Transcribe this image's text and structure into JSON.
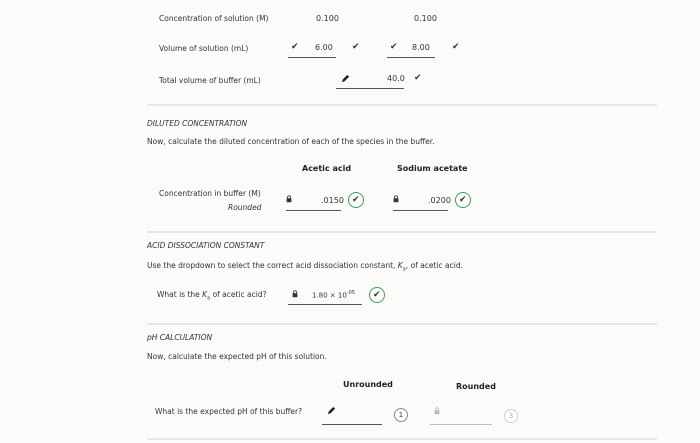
{
  "top": {
    "conc_label": "Concentration of solution (M)",
    "conc_val_1": "0.100",
    "conc_val_2": "0.100",
    "vol_label": "Volume of solution (mL)",
    "vol_val_1": "6.00",
    "vol_val_2": "8.00",
    "total_label": "Total volume of buffer (mL)",
    "total_val": "40.0"
  },
  "diluted": {
    "heading": "DILUTED CONCENTRATION",
    "instruction": "Now, calculate the diluted concentration of each of the species in the buffer.",
    "col_acetic": "Acetic acid",
    "col_sodium": "Sodium acetate",
    "row_label": "Concentration in buffer (M)",
    "row_sublabel": "Rounded",
    "acetic_val": ".0150",
    "sodium_val": ".0200"
  },
  "ka": {
    "heading": "ACID DISSOCIATION CONSTANT",
    "instruction_pre": "Use the dropdown to select the correct acid dissociation constant,",
    "instruction_post": "of acetic acid.",
    "ka_symbol": "K",
    "ka_sub": "a",
    "question_pre": "What is the",
    "question_post": "of acetic acid?",
    "value_mantissa": "1.80 × 10",
    "value_exp": "-05"
  },
  "ph": {
    "heading": "pH CALCULATION",
    "instruction": "Now, calculate the expected pH of this solution.",
    "col_unrounded": "Unrounded",
    "col_rounded": "Rounded",
    "question": "What is the expected pH of this buffer?",
    "step1": "1",
    "step3": "3"
  }
}
